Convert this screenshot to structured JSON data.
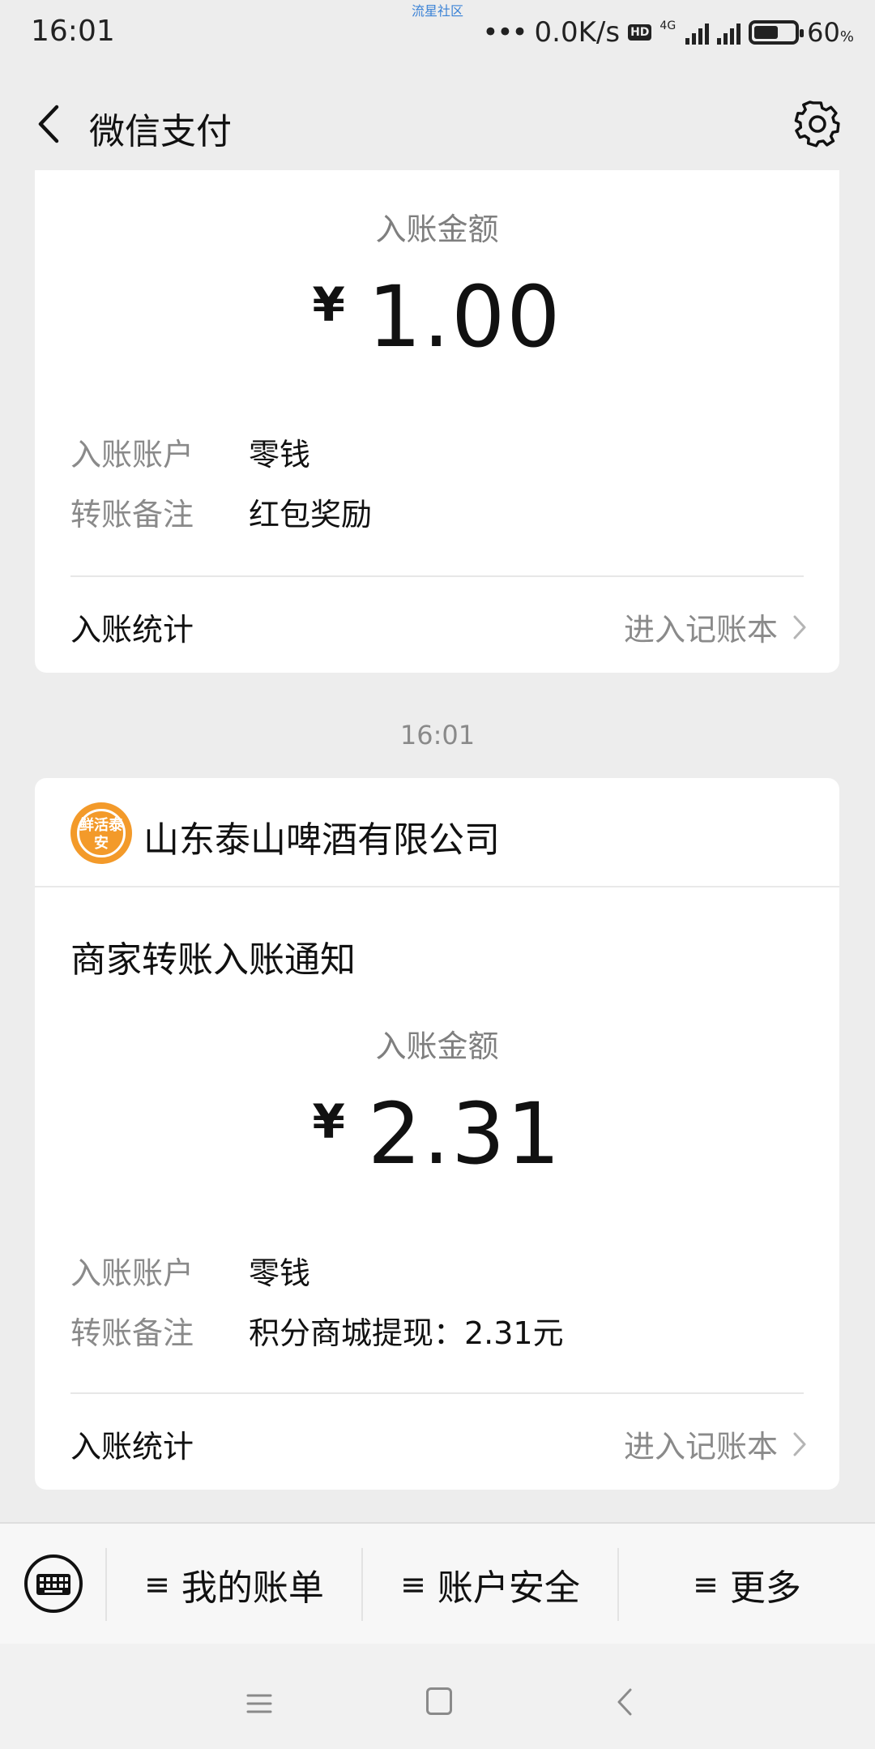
{
  "status_bar": {
    "time": "16:01",
    "watermark": "流星社区",
    "speed": "0.0K/s",
    "hd": "HD",
    "network": "4G",
    "battery_pct": "60",
    "battery_unit": "%",
    "battery_level": 0.6
  },
  "header": {
    "title": "微信支付"
  },
  "card1": {
    "amount_label": "入账金额",
    "currency": "¥",
    "amount": "1.00",
    "account_key": "入账账户",
    "account_value": "零钱",
    "remark_key": "转账备注",
    "remark_value": "红包奖励",
    "stats_label": "入账统计",
    "stats_link": "进入记账本"
  },
  "time_separator": "16:01",
  "card2": {
    "merchant_logo_text": "鲜活泰安",
    "merchant_name": "山东泰山啤酒有限公司",
    "notice_title": "商家转账入账通知",
    "amount_label": "入账金额",
    "currency": "¥",
    "amount": "2.31",
    "account_key": "入账账户",
    "account_value": "零钱",
    "remark_key": "转账备注",
    "remark_value": "积分商城提现：2.31元",
    "stats_label": "入账统计",
    "stats_link": "进入记账本"
  },
  "bottom_menu": {
    "items": [
      {
        "label": "我的账单"
      },
      {
        "label": "账户安全"
      },
      {
        "label": "更多"
      }
    ],
    "menu_glyph": "≡"
  },
  "icons": {
    "back": "chevron-left-icon",
    "settings": "gear-icon",
    "keyboard": "keyboard-icon",
    "nav_menu": "menu-icon",
    "nav_home": "home-icon",
    "nav_back": "back-icon"
  },
  "colors": {
    "background": "#ededed",
    "card": "#ffffff",
    "muted_text": "#8a8a8a",
    "logo_orange": "#f39a2a"
  }
}
